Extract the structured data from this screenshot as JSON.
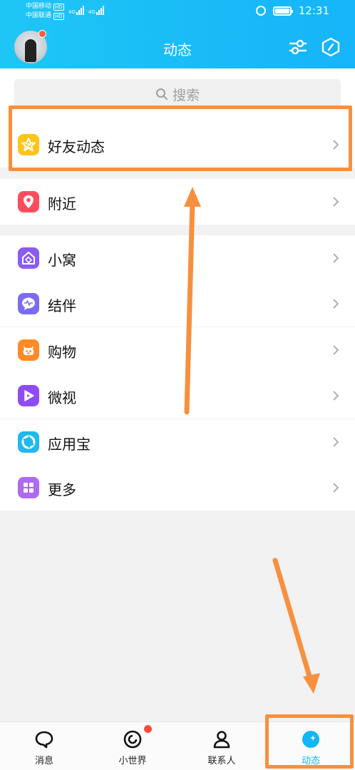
{
  "status": {
    "carrier1": "中国移动",
    "carrier2": "中国联通",
    "hd": "HD",
    "net1": "4G",
    "net2": "4G",
    "time": "12:31"
  },
  "header": {
    "title": "动态",
    "filter_icon": "sliders-icon",
    "shield_icon": "hexagon-icon"
  },
  "search": {
    "placeholder": "搜索"
  },
  "items": [
    {
      "label": "好友动态",
      "icon": "star-icon",
      "color": "#ffc417"
    },
    {
      "label": "附近",
      "icon": "location-pin-icon",
      "color": "#ff4d5e"
    },
    {
      "label": "小窝",
      "icon": "home-icon",
      "color": "#8a5cf0"
    },
    {
      "label": "结伴",
      "icon": "chat-wave-icon",
      "color": "#7a6cf2"
    },
    {
      "label": "购物",
      "icon": "shopping-bag-icon",
      "color": "#ff8a26"
    },
    {
      "label": "微视",
      "icon": "play-icon",
      "color": "#8f4bf5"
    },
    {
      "label": "应用宝",
      "icon": "app-store-icon",
      "color": "#1eb9f0"
    },
    {
      "label": "更多",
      "icon": "grid-icon",
      "color": "#b06af0"
    }
  ],
  "tabs": [
    {
      "label": "消息",
      "icon": "chat-bubble-icon",
      "active": false
    },
    {
      "label": "小世界",
      "icon": "swirl-icon",
      "active": false
    },
    {
      "label": "联系人",
      "icon": "person-icon",
      "active": false
    },
    {
      "label": "动态",
      "icon": "star-circle-icon",
      "active": true
    }
  ],
  "colors": {
    "header": "#16b4f8",
    "active_tab": "#12b7f5",
    "annotation": "#f7903e",
    "badge": "#ff4a3a"
  }
}
